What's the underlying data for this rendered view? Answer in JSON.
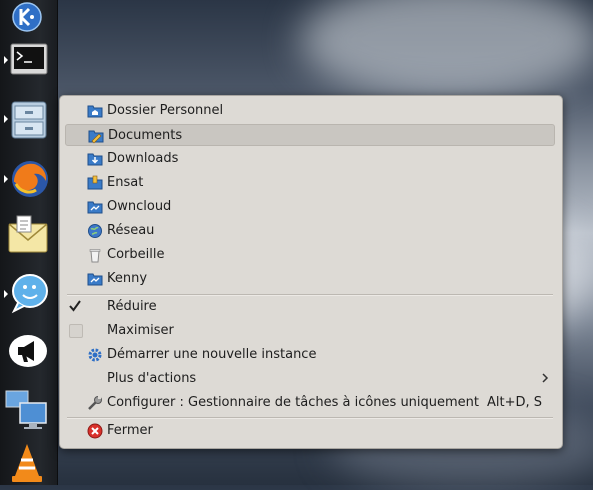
{
  "menu": {
    "places": [
      {
        "label": "Dossier Personnel",
        "icon": "home-folder-icon"
      },
      {
        "label": "Documents",
        "icon": "documents-folder-icon",
        "highlighted": true
      },
      {
        "label": "Downloads",
        "icon": "downloads-folder-icon"
      },
      {
        "label": "Ensat",
        "icon": "folder-icon"
      },
      {
        "label": "Owncloud",
        "icon": "folder-icon"
      },
      {
        "label": "Réseau",
        "icon": "network-globe-icon"
      },
      {
        "label": "Corbeille",
        "icon": "trash-icon"
      },
      {
        "label": "Kenny",
        "icon": "folder-icon"
      }
    ],
    "reduire": {
      "label": "Réduire",
      "checked": true
    },
    "maximiser": {
      "label": "Maximiser",
      "checked": false
    },
    "new_instance": {
      "label": "Démarrer une nouvelle instance"
    },
    "more_actions": {
      "label": "Plus d'actions"
    },
    "configure": {
      "label": "Configurer : Gestionnaire de tâches à icônes uniquement",
      "shortcut": "Alt+D, S"
    },
    "close": {
      "label": "Fermer"
    }
  },
  "colors": {
    "menu_bg": "#dddad5",
    "highlight": "#c9c6c1",
    "folder_blue": "#3a7bc8",
    "close_red": "#d9312b"
  }
}
